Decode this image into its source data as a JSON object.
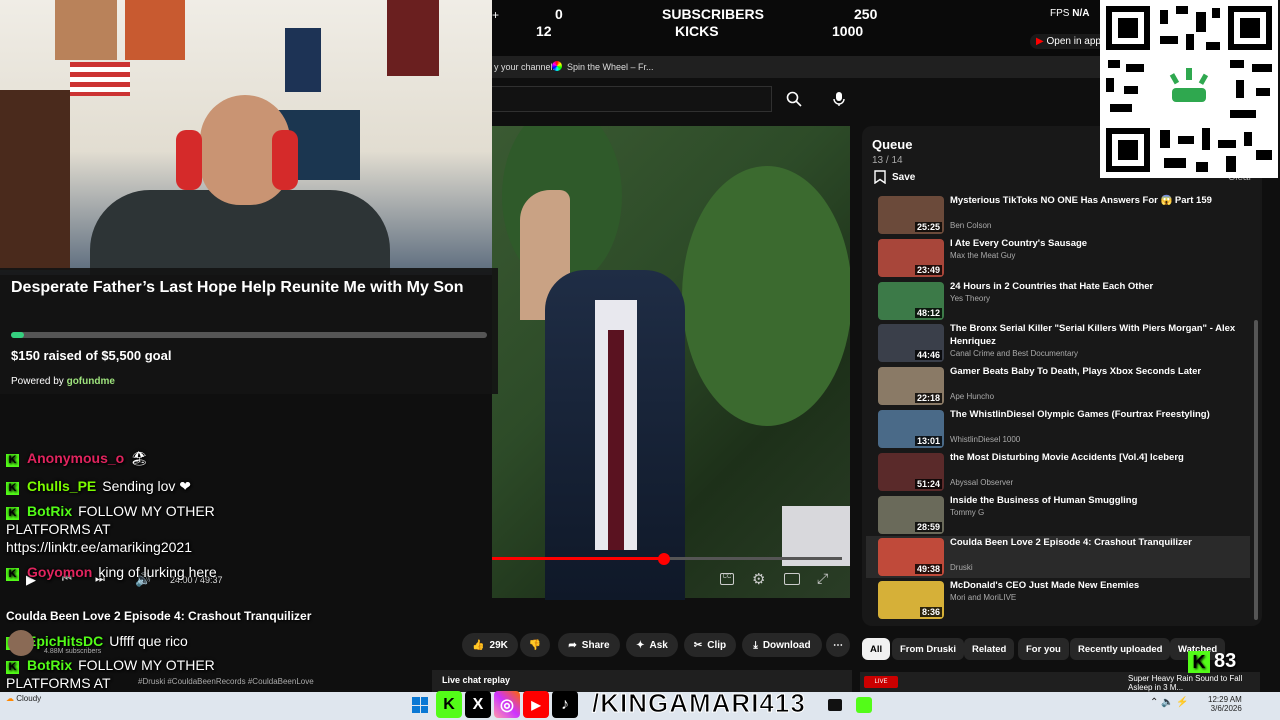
{
  "stats": {
    "subs_current": "0",
    "subs_label": "SUBSCRIBERS",
    "subs_goal": "250",
    "kicks_current": "12",
    "kicks_label": "KICKS",
    "kicks_goal": "1000"
  },
  "browser": {
    "fps_label": "FPS",
    "fps_value": "N/A",
    "open_app": "Open in app",
    "bookmark1": "y your channel!",
    "bookmark2": "Spin the Wheel – Fr..."
  },
  "fundraiser": {
    "title": "Desperate Father’s Last Hope Help Reunite Me with My Son",
    "raised_text": "$150 raised of $5,500 goal",
    "progress_fraction": 0.027,
    "powered_by": "Powered by",
    "brand": "gofundme"
  },
  "player": {
    "time": "24:00 / 49:37",
    "progress_fraction": 0.49
  },
  "chat": [
    {
      "user": "Anonymous_o",
      "color": "#e0245e",
      "text": "🏖"
    },
    {
      "user": "Chulls_PE",
      "color": "#7cfc00",
      "text": "Sending lov ❤"
    },
    {
      "user": "BotRix",
      "color": "#53fc18",
      "text": "FOLLOW MY OTHER PLATFORMS AT https://linktr.ee/amariking2021"
    },
    {
      "user": "Goyomon",
      "color": "#e0245e",
      "text": "king of lurking here"
    },
    {
      "user": "EpicHitsDC",
      "color": "#53fc18",
      "text": "Uffff que rico"
    },
    {
      "user": "BotRix",
      "color": "#53fc18",
      "text": "FOLLOW MY OTHER PLATFORMS AT https://linktr.ee/amariking2021"
    }
  ],
  "video_info": {
    "title": "Coulda Been Love 2 Episode 4: Crashout Tranquilizer",
    "channel_subs": "4.88M subscribers",
    "tags": "#Druski #CouldaBeenRecords #CouldaBeenLove"
  },
  "actions": {
    "likes": "29K",
    "share": "Share",
    "ask": "Ask",
    "clip": "Clip",
    "download": "Download"
  },
  "queue": {
    "title": "Queue",
    "count": "13 / 14",
    "save": "Save",
    "clear": "Clear",
    "items": [
      {
        "title": "Mysterious TikToks NO ONE Has Answers For 😱 Part 159",
        "channel": "Ben Colson",
        "duration": "25:25",
        "thumb": "#6b4a3a"
      },
      {
        "title": "I Ate Every Country's Sausage",
        "channel": "Max the Meat Guy",
        "duration": "23:49",
        "thumb": "#a8463a"
      },
      {
        "title": "24 Hours in 2 Countries that Hate Each Other",
        "channel": "Yes Theory",
        "duration": "48:12",
        "thumb": "#3c7a48"
      },
      {
        "title": "The Bronx Serial Killer \"Serial Killers With Piers Morgan\" - Alex Henriquez",
        "channel": "Canal Crime and Best Documentary",
        "duration": "44:46",
        "thumb": "#3a3f4a"
      },
      {
        "title": "Gamer Beats Baby To Death, Plays Xbox Seconds Later",
        "channel": "Ape Huncho",
        "duration": "22:18",
        "thumb": "#8a7a66"
      },
      {
        "title": "The WhistlinDiesel Olympic Games (Fourtrax Freestyling)",
        "channel": "WhistlinDiesel 1000",
        "duration": "13:01",
        "thumb": "#4a6a88"
      },
      {
        "title": "the Most Disturbing Movie Accidents [Vol.4] Iceberg",
        "channel": "Abyssal Observer",
        "duration": "51:24",
        "thumb": "#5a2a2a"
      },
      {
        "title": "Inside the Business of Human Smuggling",
        "channel": "Tommy G",
        "duration": "28:59",
        "thumb": "#6a6a5a"
      },
      {
        "title": "Coulda Been Love 2 Episode 4: Crashout Tranquilizer",
        "channel": "Druski",
        "duration": "49:38",
        "thumb": "#c04a3a"
      },
      {
        "title": "McDonald's CEO Just Made New Enemies",
        "channel": "Mori and MoriLIVE",
        "duration": "8:36",
        "thumb": "#d6b038"
      }
    ]
  },
  "chips": [
    "All",
    "From Druski",
    "Related",
    "For you",
    "Recently uploaded",
    "Watched"
  ],
  "livechat": "Live chat replay",
  "ticker": "Super Heavy Rain Sound to Fall Asleep in 3 M...",
  "kick_counter": "83",
  "handle": "/KINGAMARI413",
  "taskbar": {
    "weather": "Cloudy",
    "time": "12:29 AM",
    "date": "3/6/2026"
  }
}
